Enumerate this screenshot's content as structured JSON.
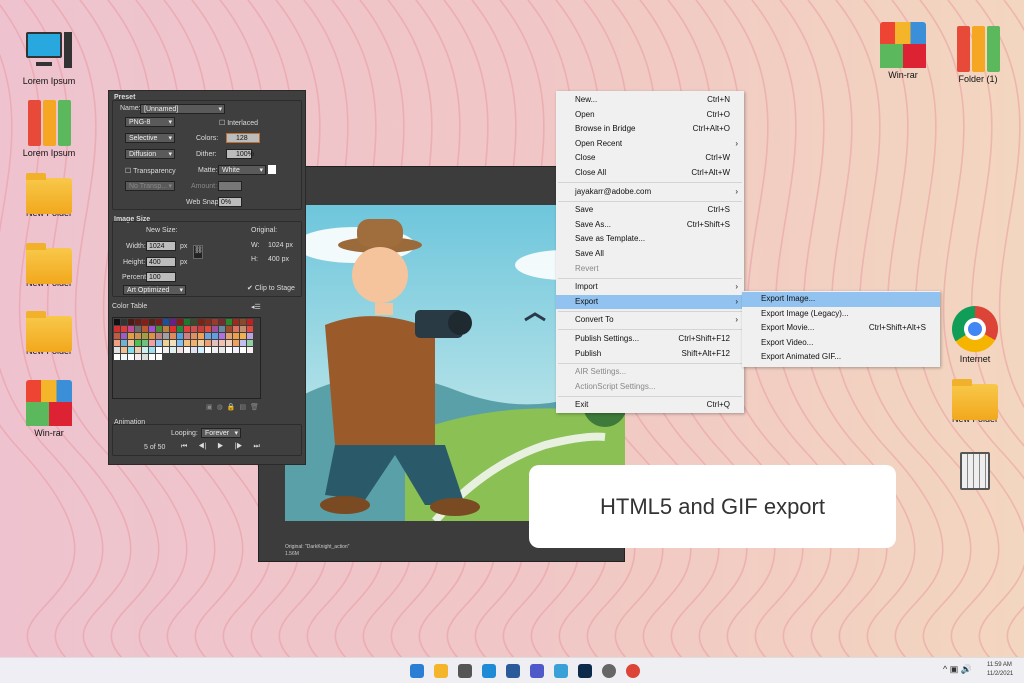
{
  "desktop": {
    "left_icons": [
      {
        "label": "Lorem Ipsum",
        "icon": "computer-icon"
      },
      {
        "label": "Lorem Ipsum",
        "icon": "binders-icon"
      },
      {
        "label": "New Folder",
        "icon": "folder-icon"
      },
      {
        "label": "New Folder",
        "icon": "folder-icon"
      },
      {
        "label": "New Folder",
        "icon": "folder-icon"
      },
      {
        "label": "Win-rar",
        "icon": "winrar-icon"
      }
    ],
    "right_icons": [
      {
        "label": "Win-rar",
        "icon": "winrar-icon"
      },
      {
        "label": "Folder (1)",
        "icon": "binders-icon"
      },
      {
        "label": "Internet",
        "icon": "chrome-icon"
      },
      {
        "label": "New Folder",
        "icon": "folder-icon"
      },
      {
        "label": "",
        "icon": "recycle-bin-icon"
      }
    ]
  },
  "panel": {
    "preset": {
      "title": "Preset",
      "name_label": "Name:",
      "name_value": "[Unnamed]",
      "format": "PNG-8",
      "interlaced": "Interlaced",
      "palette": "Selective",
      "colors_label": "Colors:",
      "colors_value": "128",
      "dither_method": "Diffusion",
      "dither_label": "Dither:",
      "dither_value": "100%",
      "transparency": "Transparency",
      "matte_label": "Matte:",
      "matte_value": "White",
      "no_transp": "No Transp...",
      "amount_label": "Amount:",
      "websnap_label": "Web Snap:",
      "websnap_value": "0%"
    },
    "image_size": {
      "title": "Image Size",
      "new_size": "New Size:",
      "width_label": "Width:",
      "width_value": "1024",
      "height_label": "Height:",
      "height_value": "400",
      "unit": "px",
      "percent_label": "Percent:",
      "percent_value": "100",
      "quality": "Art Optimized",
      "original": "Original:",
      "orig_w": "W:",
      "orig_w_val": "1024 px",
      "orig_h": "H:",
      "orig_h_val": "400 px",
      "clip": "Clip to Stage"
    },
    "color_table": {
      "title": "Color Table",
      "colors": [
        "#111",
        "#333",
        "#4a1a14",
        "#6b1c14",
        "#8a1c18",
        "#5a2214",
        "#7a1a1a",
        "#1a4fa0",
        "#6a1e8a",
        "#8a1a1a",
        "#1e7a2a",
        "#3a4a2a",
        "#7a2418",
        "#8a2a1a",
        "#9a3a2a",
        "#7a2a2a",
        "#2a8a2a",
        "#a02a1a",
        "#8a4a2a",
        "#c02020",
        "#d03030",
        "#e03a3a",
        "#c04a9a",
        "#6a6a6a",
        "#c05a30",
        "#a050d0",
        "#4a8a3a",
        "#c08040",
        "#e03030",
        "#2a8a3a",
        "#e04040",
        "#d05050",
        "#c04040",
        "#e04a3a",
        "#a050a0",
        "#6a8aa0",
        "#a04a2a",
        "#e07060",
        "#c09070",
        "#e04a40",
        "#c05a40",
        "#9a60c0",
        "#e0a040",
        "#d09050",
        "#a0a040",
        "#e09040",
        "#c08080",
        "#a0a0a0",
        "#e08a5a",
        "#50a0e0",
        "#d08080",
        "#e09060",
        "#f0a050",
        "#70a0e0",
        "#60a0e0",
        "#b070e0",
        "#e0a070",
        "#f0a040",
        "#f0b050",
        "#c0a0e0",
        "#f0a080",
        "#70b0d0",
        "#f0c0a0",
        "#50c050",
        "#70c080",
        "#f0a0a0",
        "#90c0f0",
        "#f0d090",
        "#f0e0c0",
        "#80c0f0",
        "#f0c080",
        "#f0b070",
        "#f0d0a0",
        "#f0a070",
        "#e0c0c0",
        "#f0c0b0",
        "#f0d0c0",
        "#f0a060",
        "#c0c0f0",
        "#90d0a0",
        "#e0e0e0",
        "#f0c090",
        "#80e0f0",
        "#f0d0b0",
        "#d0f0f0",
        "#a0e0f0",
        "#fff",
        "#f0f0f0",
        "#e0f0f0",
        "#f0e0e0",
        "#f8f8f8",
        "#e0e0f0",
        "#d0f0ff",
        "#fff",
        "#f0f0f0",
        "#e8e8e8",
        "#fff",
        "#f0f0ff",
        "#ffffff",
        "#f8f0f0",
        "#fff",
        "#f0f8f8",
        "#fff",
        "#eee",
        "#ddd",
        "#fff",
        "#fff"
      ]
    },
    "animation": {
      "title": "Animation",
      "looping_label": "Looping:",
      "looping_value": "Forever",
      "frame": "5 of 50"
    }
  },
  "canvas": {
    "status_line1": "Original: \"DarkKnight_action\"",
    "status_line2": "1.56M"
  },
  "file_menu": {
    "items": [
      {
        "label": "New...",
        "shortcut": "Ctrl+N"
      },
      {
        "label": "Open",
        "shortcut": "Ctrl+O"
      },
      {
        "label": "Browse in Bridge",
        "shortcut": "Ctrl+Alt+O"
      },
      {
        "label": "Open Recent",
        "arrow": true
      },
      {
        "label": "Close",
        "shortcut": "Ctrl+W"
      },
      {
        "label": "Close All",
        "shortcut": "Ctrl+Alt+W"
      },
      {
        "sep": true
      },
      {
        "label": "jayakarr@adobe.com",
        "arrow": true
      },
      {
        "sep": true
      },
      {
        "label": "Save",
        "shortcut": "Ctrl+S"
      },
      {
        "label": "Save As...",
        "shortcut": "Ctrl+Shift+S"
      },
      {
        "label": "Save as Template..."
      },
      {
        "label": "Save All"
      },
      {
        "label": "Revert",
        "disabled": true
      },
      {
        "sep": true
      },
      {
        "label": "Import",
        "arrow": true
      },
      {
        "label": "Export",
        "arrow": true,
        "highlight": true
      },
      {
        "sep": true
      },
      {
        "label": "Convert To",
        "arrow": true
      },
      {
        "sep": true
      },
      {
        "label": "Publish Settings...",
        "shortcut": "Ctrl+Shift+F12"
      },
      {
        "label": "Publish",
        "shortcut": "Shift+Alt+F12"
      },
      {
        "sep": true
      },
      {
        "label": "AIR Settings...",
        "disabled": true
      },
      {
        "label": "ActionScript Settings...",
        "disabled": true
      },
      {
        "sep": true
      },
      {
        "label": "Exit",
        "shortcut": "Ctrl+Q"
      }
    ]
  },
  "export_submenu": {
    "items": [
      {
        "label": "Export Image...",
        "highlight": true
      },
      {
        "label": "Export Image (Legacy)..."
      },
      {
        "label": "Export Movie...",
        "shortcut": "Ctrl+Shift+Alt+S"
      },
      {
        "label": "Export Video..."
      },
      {
        "label": "Export Animated GIF..."
      }
    ]
  },
  "callout": {
    "text": "HTML5 and GIF export"
  },
  "taskbar": {
    "time": "11:59 AM",
    "date": "11/2/2021",
    "apps": [
      "windows-start-icon",
      "file-explorer-icon",
      "camera-icon",
      "edge-icon",
      "store-icon",
      "teams-icon",
      "paint-icon",
      "animate-app-icon",
      "settings-icon",
      "chrome-icon"
    ]
  },
  "colors": {
    "menu_highlight": "#92c3f0",
    "panel_bg": "#3f3f3f"
  }
}
